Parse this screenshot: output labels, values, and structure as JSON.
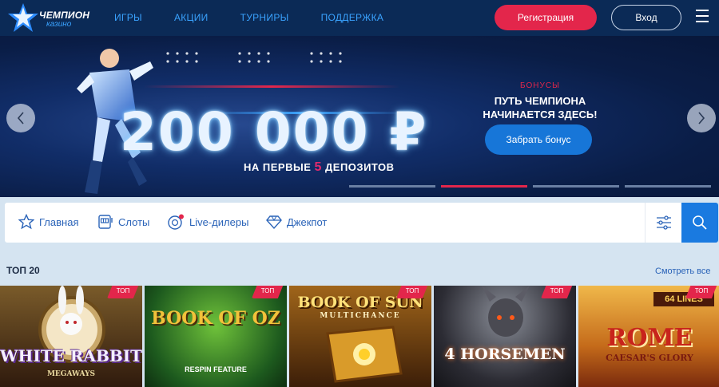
{
  "brand": {
    "name": "ЧЕМПИОН",
    "sub": "казино"
  },
  "nav": [
    "ИГРЫ",
    "АКЦИИ",
    "ТУРНИРЫ",
    "ПОДДЕРЖКА"
  ],
  "header": {
    "register_label": "Регистрация",
    "login_label": "Вход"
  },
  "banner": {
    "amount": "200 000 ₽",
    "deposits_prefix": "НА ПЕРВЫЕ",
    "deposits_count": "5",
    "deposits_suffix": "ДЕПОЗИТОВ",
    "promo_label": "БОНУСЫ",
    "promo_title": "ПУТЬ ЧЕМПИОНА НАЧИНАЕТСЯ ЗДЕСЬ!",
    "cta": "Забрать бонус",
    "slides_total": 4,
    "active_slide": 2
  },
  "categories": [
    {
      "label": "Главная",
      "icon": "star-icon"
    },
    {
      "label": "Слоты",
      "icon": "slot-machine-icon"
    },
    {
      "label": "Live-дилеры",
      "icon": "live-dealer-icon"
    },
    {
      "label": "Джекпот",
      "icon": "diamond-icon"
    }
  ],
  "top": {
    "title": "ТОП 20",
    "see_all": "Смотреть все",
    "badge": "ТОП",
    "games": [
      {
        "name": "WHITE RABBIT",
        "subtitle": "MEGAWAYS",
        "colors": [
          "#7a5b2a",
          "#2f1a0d"
        ]
      },
      {
        "name": "BOOK OF OZ",
        "subtitle": "RESPIN FEATURE",
        "colors": [
          "#3d8a3a",
          "#0f3d1a"
        ]
      },
      {
        "name": "BOOK OF SUN",
        "subtitle": "MULTICHANCE",
        "colors": [
          "#a0651a",
          "#3c1e08"
        ]
      },
      {
        "name": "4 HORSEMEN",
        "subtitle": "",
        "colors": [
          "#6a6e78",
          "#1c1c22"
        ]
      },
      {
        "name": "ROME",
        "subtitle": "CAESAR'S GLORY",
        "lines": "64 LINES",
        "colors": [
          "#d98a1c",
          "#7a2a0d"
        ]
      }
    ]
  }
}
